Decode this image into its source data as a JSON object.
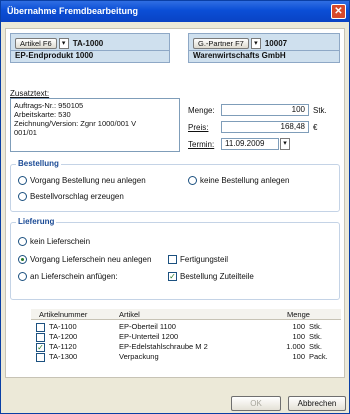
{
  "window": {
    "title": "Übernahme Fremdbearbeitung",
    "close_label": "✕"
  },
  "left_box": {
    "button": "Artikel F6",
    "dropdown": "▾",
    "code": "TA-1000",
    "name": "EP-Endprodukt 1000"
  },
  "right_box": {
    "button": "G.-Partner F7",
    "dropdown": "▾",
    "code": "10007",
    "name": "Warenwirtschafts GmbH"
  },
  "zusatztext": {
    "label": "Zusatztext:",
    "lines": [
      "Auftrags-Nr.: 950105",
      "Arbeitskarte: 530",
      "Zeichnung/Version: Zgnr 1000/001  V",
      "001/01"
    ]
  },
  "menge": {
    "label": "Menge:",
    "value": "100",
    "unit": "Stk."
  },
  "preis": {
    "label": "Preis:",
    "value": "168,48",
    "unit": "€"
  },
  "termin": {
    "label": "Termin:",
    "value": "11.09.2009",
    "dropdown": "▾"
  },
  "bestellung": {
    "title": "Bestellung",
    "options": [
      "Vorgang Bestellung neu anlegen",
      "Bestellvorschlag erzeugen",
      "keine Bestellung anlegen"
    ]
  },
  "lieferung": {
    "title": "Lieferung",
    "options": [
      "kein Lieferschein",
      "Vorgang Lieferschein neu anlegen",
      "an Lieferschein anfügen:"
    ],
    "checks": [
      "Fertigungsteil",
      "Bestellung Zuteilteile"
    ]
  },
  "table": {
    "headers": [
      "Artikelnummer",
      "Artikel",
      "Menge"
    ],
    "rows": [
      {
        "checked": false,
        "nr": "TA-1100",
        "artikel": "EP-Oberteil 1100",
        "menge": "100",
        "unit": "Stk."
      },
      {
        "checked": false,
        "nr": "TA-1200",
        "artikel": "EP-Unterteil 1200",
        "menge": "100",
        "unit": "Stk."
      },
      {
        "checked": true,
        "nr": "TA-1120",
        "artikel": "EP-Edelstahlschraube M 2",
        "menge": "1.000",
        "unit": "Stk."
      },
      {
        "checked": false,
        "nr": "TA-1300",
        "artikel": "Verpackung",
        "menge": "100",
        "unit": "Pack."
      }
    ]
  },
  "buttons": {
    "ok": "OK",
    "cancel": "Abbrechen"
  }
}
